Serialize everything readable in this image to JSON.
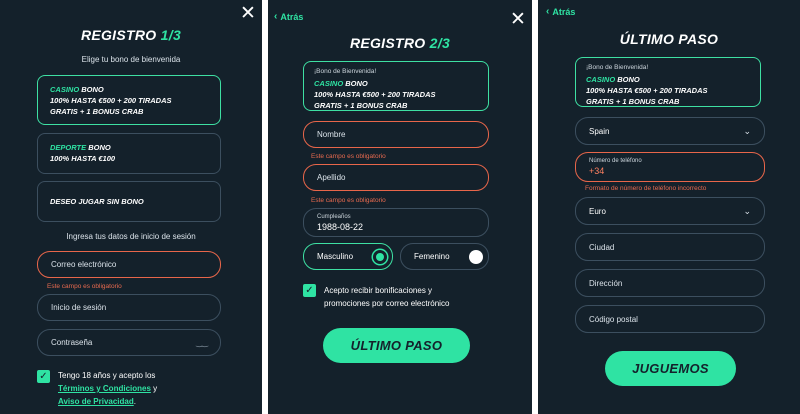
{
  "icons": {
    "close": "✕",
    "back": "‹",
    "check": "✓",
    "caret": "⌄",
    "eye": "‿‿"
  },
  "colors": {
    "accent": "#2fe3a3",
    "error": "#e8664a",
    "background": "#14212b",
    "border": "#3c4f5f"
  },
  "step1": {
    "title_main": "REGISTRO",
    "title_num": "1/3",
    "subtitle": "Elige tu bono de bienvenida",
    "bonus_casino": {
      "highlight": "CASINO",
      "rest": "BONO",
      "line2": "100% HASTA €500 + 200 TIRADAS",
      "line3": "GRATIS + 1 BONUS CRAB"
    },
    "bonus_sport": {
      "highlight": "DEPORTE",
      "rest": "BONO",
      "line2": "100% HASTA €100"
    },
    "no_bonus": "DESEO JUGAR SIN BONO",
    "login_subtitle": "Ingresa tus datos de inicio de sesión",
    "email_placeholder": "Correo electrónico",
    "email_error": "Este campo es obligatorio",
    "login_placeholder": "Inicio de sesión",
    "password_placeholder": "Contraseña",
    "terms_prefix": "Tengo 18 años y acepto los",
    "terms_link": "Términos y Condiciones",
    "terms_and": " y",
    "privacy_link": "Aviso de Privacidad",
    "privacy_suffix": "."
  },
  "step2": {
    "back_label": "Atrás",
    "title_main": "REGISTRO",
    "title_num": "2/3",
    "bonus_small": "¡Bono de Bienvenida!",
    "bonus_highlight": "CASINO",
    "bonus_rest": "BONO",
    "bonus_line2": "100% HASTA €500 + 200 TIRADAS",
    "bonus_line3": "GRATIS + 1 BONUS CRAB",
    "name_placeholder": "Nombre",
    "name_error": "Este campo es obligatorio",
    "surname_placeholder": "Apellido",
    "surname_error": "Este campo es obligatorio",
    "birthday_label": "Cumpleaños",
    "birthday_value": "1988-08-22",
    "gender_male": "Masculino",
    "gender_female": "Femenino",
    "promo_consent": "Acepto recibir bonificaciones y",
    "promo_consent2": "promociones por correo electrónico",
    "cta": "ÚLTIMO PASO"
  },
  "step3": {
    "back_label": "Atrás",
    "title": "ÚLTIMO PASO",
    "bonus_small": "¡Bono de Bienvenida!",
    "bonus_highlight": "CASINO",
    "bonus_rest": "BONO",
    "bonus_line2": "100% HASTA €500 + 200 TIRADAS",
    "bonus_line3": "GRATIS + 1 BONUS CRAB",
    "country_value": "Spain",
    "phone_label": "Número de teléfono",
    "phone_value": "+34",
    "phone_error": "Formato de número de teléfono incorrecto",
    "currency_value": "Euro",
    "city_placeholder": "Ciudad",
    "address_placeholder": "Dirección",
    "postal_placeholder": "Código postal",
    "cta": "JUGUEMOS"
  }
}
